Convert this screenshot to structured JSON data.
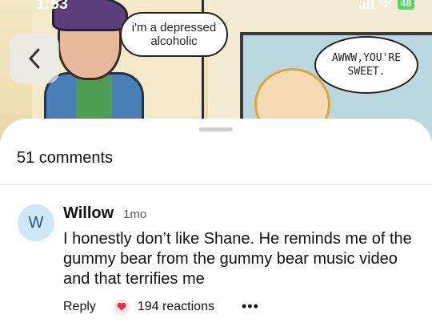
{
  "status_bar": {
    "time": "1:53",
    "battery": "48"
  },
  "background": {
    "bubble_left": "i'm a depressed alcoholic",
    "bubble_right": "AWWW,YOU'RE SWEET."
  },
  "header": {
    "comments_count": "51 comments"
  },
  "comment": {
    "avatar_initial": "W",
    "author": "Willow",
    "time_ago": "1mo",
    "text": "I honestly don’t like Shane. He reminds me of the gummy bear from the gummy bear music video and that terrifies me",
    "reply_label": "Reply",
    "reactions_label": "194 reactions",
    "more_label": "•••"
  },
  "icons": {
    "back": "chevron-left-icon",
    "reaction": "heart-icon",
    "wifi": "wifi-icon",
    "signal": "signal-icon",
    "battery": "battery-icon"
  },
  "colors": {
    "avatar_bg": "#cfe8f5",
    "avatar_text": "#1f5a85",
    "reaction_heart": "#e0304a",
    "battery_green": "#4cd964"
  }
}
